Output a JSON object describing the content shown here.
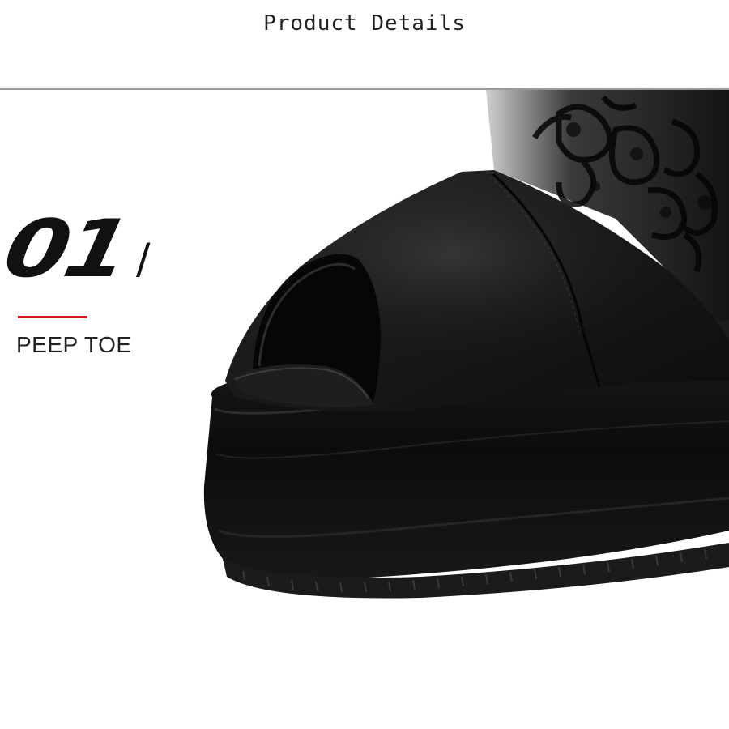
{
  "header": {
    "title": "Product Details"
  },
  "feature": {
    "number": "01",
    "separator": "/",
    "label": "PEEP TOE",
    "accent_color": "#d11a22"
  },
  "image": {
    "subject": "black-platform-peep-toe-shoe-icon"
  }
}
